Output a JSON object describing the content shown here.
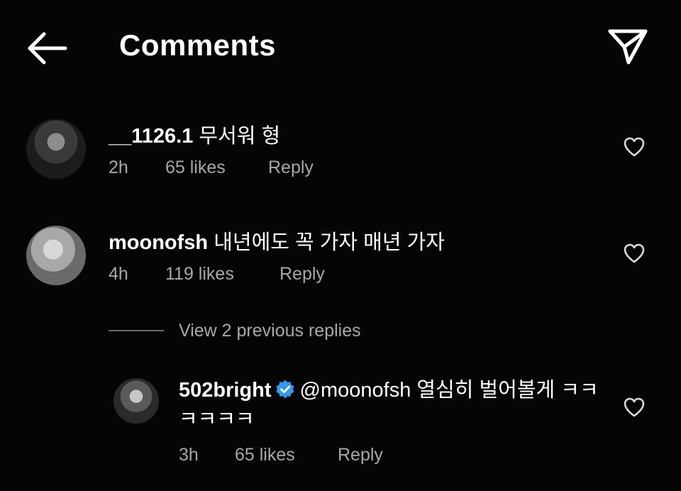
{
  "header": {
    "title": "Comments",
    "back_icon": "arrow-left-icon",
    "send_icon": "paper-plane-icon"
  },
  "colors": {
    "background": "#050505",
    "text": "#ffffff",
    "muted": "#a8a8a8",
    "verified": "#3897f0"
  },
  "comments": [
    {
      "username": "__1126.1",
      "text": "무서워 형",
      "time": "2h",
      "likes": "65 likes",
      "reply_label": "Reply"
    },
    {
      "username": "moonofsh",
      "text": "내년에도 꼭 가자 매년 가자",
      "time": "4h",
      "likes": "119 likes",
      "reply_label": "Reply"
    }
  ],
  "view_replies_label": "View 2 previous replies",
  "reply": {
    "username": "502bright",
    "verified_icon": "verified-badge-icon",
    "mention": "@moonofsh",
    "text": "열심히 벌어볼게 ㅋㅋㅋㅋㅋㅋ",
    "time": "3h",
    "likes": "65 likes",
    "reply_label": "Reply"
  }
}
